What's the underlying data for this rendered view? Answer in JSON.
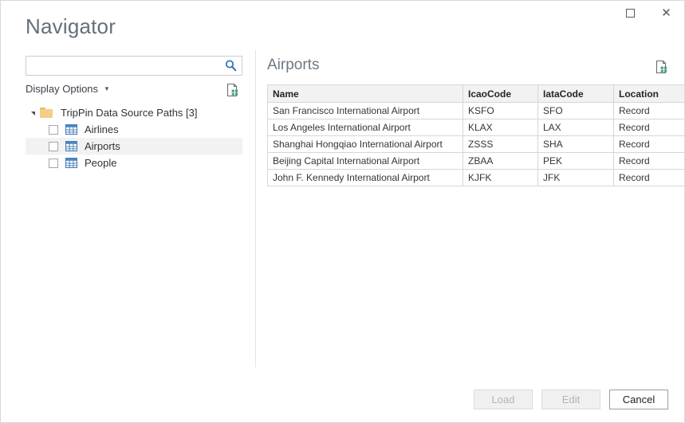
{
  "window": {
    "title": "Navigator",
    "controls": [
      {
        "name": "maximize-button",
        "label": "Maximize"
      },
      {
        "name": "close-button",
        "label": "Close"
      }
    ]
  },
  "search": {
    "value": "",
    "placeholder": "",
    "icon": "search-icon"
  },
  "display_options": {
    "label": "Display Options",
    "caret": "▾",
    "refresh_icon": "refresh-document-icon"
  },
  "tree": {
    "root": {
      "label": "TripPin Data Source Paths [3]",
      "expanded": true,
      "icon": "folder-icon",
      "expander": "▴"
    },
    "items": [
      {
        "label": "Airlines",
        "checked": false,
        "selected": false,
        "icon": "table-grid-icon"
      },
      {
        "label": "Airports",
        "checked": false,
        "selected": true,
        "icon": "table-grid-icon"
      },
      {
        "label": "People",
        "checked": false,
        "selected": false,
        "icon": "table-grid-icon"
      }
    ]
  },
  "preview": {
    "title": "Airports",
    "refresh_icon": "refresh-document-icon",
    "columns": [
      "Name",
      "IcaoCode",
      "IataCode",
      "Location"
    ],
    "rows": [
      [
        "San Francisco International Airport",
        "KSFO",
        "SFO",
        "Record"
      ],
      [
        "Los Angeles International Airport",
        "KLAX",
        "LAX",
        "Record"
      ],
      [
        "Shanghai Hongqiao International Airport",
        "ZSSS",
        "SHA",
        "Record"
      ],
      [
        "Beijing Capital International Airport",
        "ZBAA",
        "PEK",
        "Record"
      ],
      [
        "John F. Kennedy International Airport",
        "KJFK",
        "JFK",
        "Record"
      ]
    ]
  },
  "footer": {
    "buttons": [
      {
        "label": "Load",
        "name": "load-button",
        "enabled": false
      },
      {
        "label": "Edit",
        "name": "edit-button",
        "enabled": false
      },
      {
        "label": "Cancel",
        "name": "cancel-button",
        "enabled": true
      }
    ]
  },
  "colors": {
    "title_text": "#666f7a",
    "accent_blue": "#2f6fb5",
    "folder": "#f5cd86",
    "refresh_green": "#4f9e84",
    "selection": "#f2f2f2",
    "header_fill": "#f2f2f2",
    "border": "#d6d6d6"
  }
}
